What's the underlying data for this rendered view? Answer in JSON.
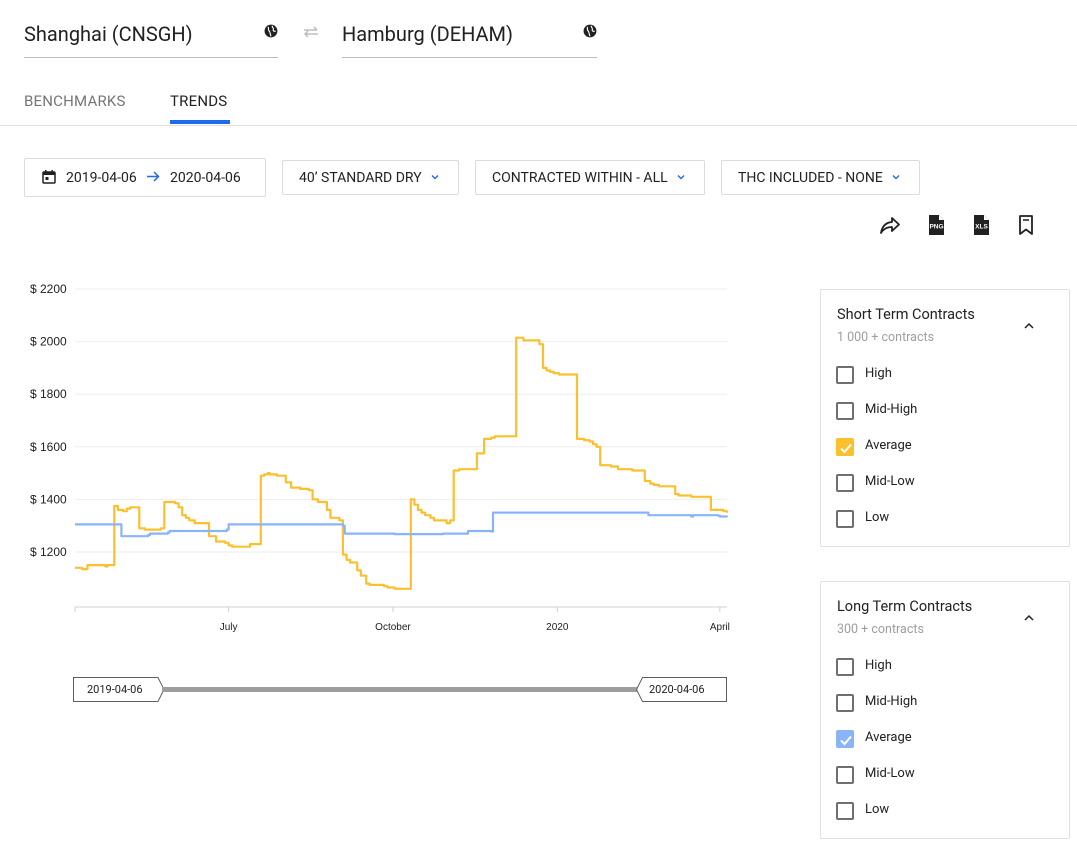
{
  "route": {
    "origin": "Shanghai (CNSGH)",
    "origin_icon": "globe-icon",
    "swap_icon": "swap-arrows-icon",
    "destination": "Hamburg (DEHAM)",
    "destination_icon": "globe-icon"
  },
  "tabs": {
    "items": [
      {
        "label": "BENCHMARKS",
        "active": false
      },
      {
        "label": "TRENDS",
        "active": true
      }
    ],
    "accent_color": "#1e6bf0"
  },
  "filters": {
    "date_from": "2019-04-06",
    "date_to": "2020-04-06",
    "date_icon": "calendar-icon",
    "container": "40’ STANDARD DRY",
    "contracted": "CONTRACTED WITHIN - ALL",
    "thc": "THC INCLUDED - NONE"
  },
  "actions": [
    "share-icon",
    "png-export-icon",
    "xls-export-icon",
    "bookmark-icon"
  ],
  "chart_data": {
    "type": "line",
    "y_ticks": [
      "$ 2200",
      "$ 2000",
      "$ 1800",
      "$ 1600",
      "$ 1400",
      "$ 1200"
    ],
    "ylim": [
      1000,
      2200
    ],
    "x_ticks": [
      "July",
      "October",
      "2020",
      "April"
    ],
    "x_range": [
      "2019-04-06",
      "2020-04-06"
    ],
    "grid": true,
    "series": [
      {
        "color": "#fbc02d",
        "x_day": [
          0,
          4,
          7,
          17,
          18,
          22,
          24,
          27,
          29,
          31,
          36,
          39,
          41,
          48,
          50,
          52,
          56,
          58,
          60,
          62,
          64,
          67,
          71,
          73,
          75,
          77,
          79,
          84,
          86,
          88,
          90,
          98,
          104,
          106,
          108,
          109,
          113,
          118,
          121,
          126,
          131,
          133,
          136,
          141,
          143,
          148,
          150,
          152,
          154,
          158,
          160,
          163,
          165,
          168,
          173,
          175,
          179,
          188,
          190,
          192,
          194,
          196,
          199,
          201,
          206,
          208,
          210,
          212,
          215,
          217,
          220,
          225,
          229,
          233,
          235,
          238,
          247,
          251,
          260,
          262,
          264,
          266,
          268,
          271,
          274,
          281,
          285,
          288,
          290,
          292,
          294,
          300,
          304,
          312,
          319,
          322,
          324,
          327,
          330,
          336,
          338,
          340,
          345,
          347,
          352,
          354,
          356,
          363,
          365
        ],
        "y": [
          1140,
          1135,
          1150,
          1145,
          1150,
          1375,
          1360,
          1355,
          1365,
          1370,
          1290,
          1285,
          1285,
          1290,
          1390,
          1390,
          1385,
          1370,
          1340,
          1330,
          1320,
          1310,
          1310,
          1310,
          1260,
          1260,
          1240,
          1235,
          1225,
          1220,
          1220,
          1230,
          1490,
          1495,
          1500,
          1495,
          1490,
          1465,
          1445,
          1440,
          1435,
          1400,
          1390,
          1360,
          1330,
          1320,
          1190,
          1170,
          1160,
          1130,
          1110,
          1080,
          1075,
          1075,
          1070,
          1065,
          1060,
          1400,
          1380,
          1360,
          1350,
          1340,
          1330,
          1320,
          1320,
          1310,
          1320,
          1510,
          1515,
          1515,
          1515,
          1575,
          1630,
          1635,
          1640,
          1640,
          2015,
          2005,
          1990,
          1900,
          1890,
          1885,
          1880,
          1875,
          1875,
          1630,
          1625,
          1620,
          1610,
          1600,
          1530,
          1525,
          1515,
          1510,
          1470,
          1460,
          1455,
          1450,
          1450,
          1420,
          1415,
          1415,
          1410,
          1410,
          1410,
          1410,
          1360,
          1355,
          1350
        ]
      },
      {
        "color": "#8ab4f8",
        "x_day": [
          0,
          25,
          26,
          41,
          42,
          52,
          53,
          85,
          86,
          150,
          151,
          178,
          179,
          205,
          206,
          220,
          221,
          233,
          234,
          320,
          321,
          345,
          346,
          360,
          361,
          365
        ],
        "y": [
          1305,
          1305,
          1260,
          1265,
          1270,
          1275,
          1280,
          1285,
          1305,
          1300,
          1270,
          1270,
          1268,
          1268,
          1270,
          1280,
          1280,
          1278,
          1350,
          1350,
          1340,
          1335,
          1340,
          1338,
          1335,
          1333
        ]
      }
    ]
  },
  "range_slider": {
    "start": "2019-04-06",
    "end": "2020-04-06"
  },
  "short_term": {
    "title": "Short Term Contracts",
    "subtitle": "1 000 + contracts",
    "collapse_icon": "chevron-up-icon",
    "check_color": "#fbc02d",
    "options": [
      {
        "label": "High",
        "checked": false
      },
      {
        "label": "Mid-High",
        "checked": false
      },
      {
        "label": "Average",
        "checked": true
      },
      {
        "label": "Mid-Low",
        "checked": false
      },
      {
        "label": "Low",
        "checked": false
      }
    ]
  },
  "long_term": {
    "title": "Long Term Contracts",
    "subtitle": "300 + contracts",
    "collapse_icon": "chevron-up-icon",
    "check_color": "#8ab4f8",
    "options": [
      {
        "label": "High",
        "checked": false
      },
      {
        "label": "Mid-High",
        "checked": false
      },
      {
        "label": "Average",
        "checked": true
      },
      {
        "label": "Mid-Low",
        "checked": false
      },
      {
        "label": "Low",
        "checked": false
      }
    ]
  }
}
